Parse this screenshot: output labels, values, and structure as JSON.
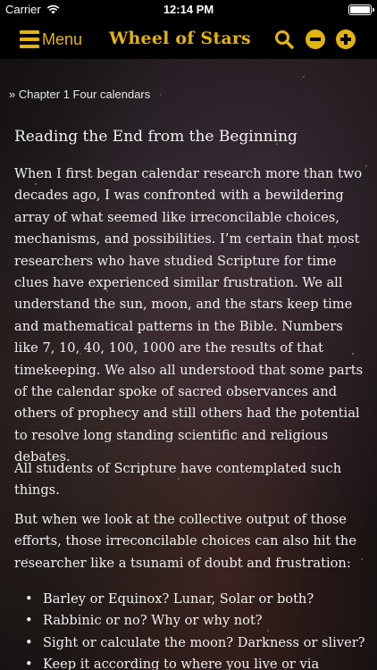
{
  "status_bar": {
    "carrier": "Carrier",
    "time": "12:14 PM"
  },
  "nav": {
    "menu_label": "Menu",
    "app_title": "Wheel of Stars",
    "icons": [
      "hamburger-icon",
      "search-icon",
      "zoom-out-icon",
      "zoom-in-icon"
    ],
    "accent_color": "#e3b410"
  },
  "content": {
    "breadcrumb": "» Chapter 1 Four calendars",
    "heading": "Reading the End from the Beginning",
    "paragraphs": [
      "When I first began calendar research more than two decades ago, I was confronted with a bewildering array of what seemed like irreconcilable choices, mechanisms, and possibilities. I’m certain that most researchers who have studied Scripture for time clues have experienced similar frustration. We all understand the sun, moon, and the stars keep time and mathematical patterns in the Bible. Numbers like 7, 10, 40, 100, 1000 are the results of that timekeeping. We also all understood that some parts of the calendar spoke of sacred observances and others of prophecy and still others had the potential to resolve long standing scientific and religious debates.",
      "All students of Scripture have contemplated such things.",
      "But when we look at the collective output of those efforts, those irreconcilable choices can also hit the researcher like a tsunami of doubt and frustration:"
    ],
    "bullets": [
      "Barley or Equinox? Lunar, Solar or both?",
      "Rabbinic or no? Why or why not?",
      "Sight or calculate the moon? Darkness or sliver?",
      "Keep it according to where you live or via"
    ]
  }
}
